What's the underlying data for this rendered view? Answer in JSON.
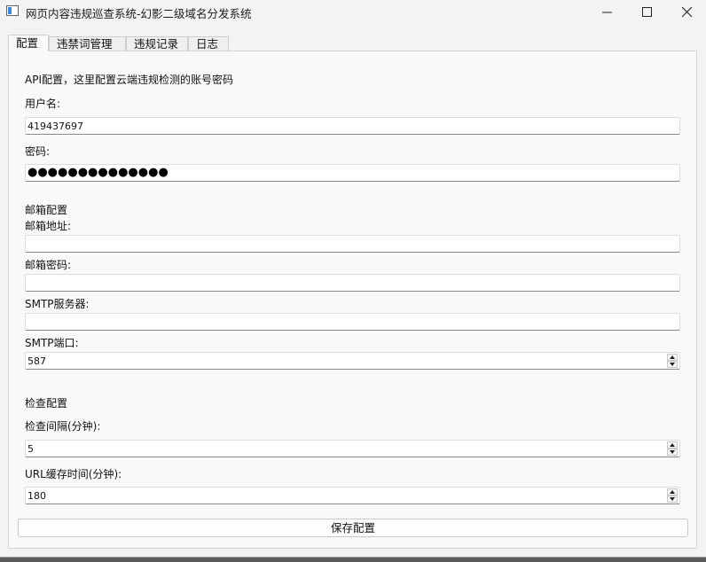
{
  "window": {
    "title": "网页内容违规巡查系统-幻影二级域名分发系统"
  },
  "tabs": [
    {
      "label": "配置",
      "active": true
    },
    {
      "label": "违禁词管理",
      "active": false
    },
    {
      "label": "违规记录",
      "active": false
    },
    {
      "label": "日志",
      "active": false
    }
  ],
  "api": {
    "heading": "API配置，这里配置云端违规检测的账号密码",
    "username_label": "用户名:",
    "username_value": "419437697",
    "password_label": "密码:",
    "password_mask": "●●●●●●●●●●●●●●"
  },
  "email": {
    "heading": "邮箱配置",
    "address_label": "邮箱地址:",
    "address_value": "",
    "password_label": "邮箱密码:",
    "password_value": "",
    "smtp_server_label": "SMTP服务器:",
    "smtp_server_value": "",
    "smtp_port_label": "SMTP端口:",
    "smtp_port_value": "587"
  },
  "check": {
    "heading": "检查配置",
    "interval_label": "检查间隔(分钟):",
    "interval_value": "5",
    "cache_label": "URL缓存时间(分钟):",
    "cache_value": "180"
  },
  "buttons": {
    "save_label": "保存配置"
  }
}
